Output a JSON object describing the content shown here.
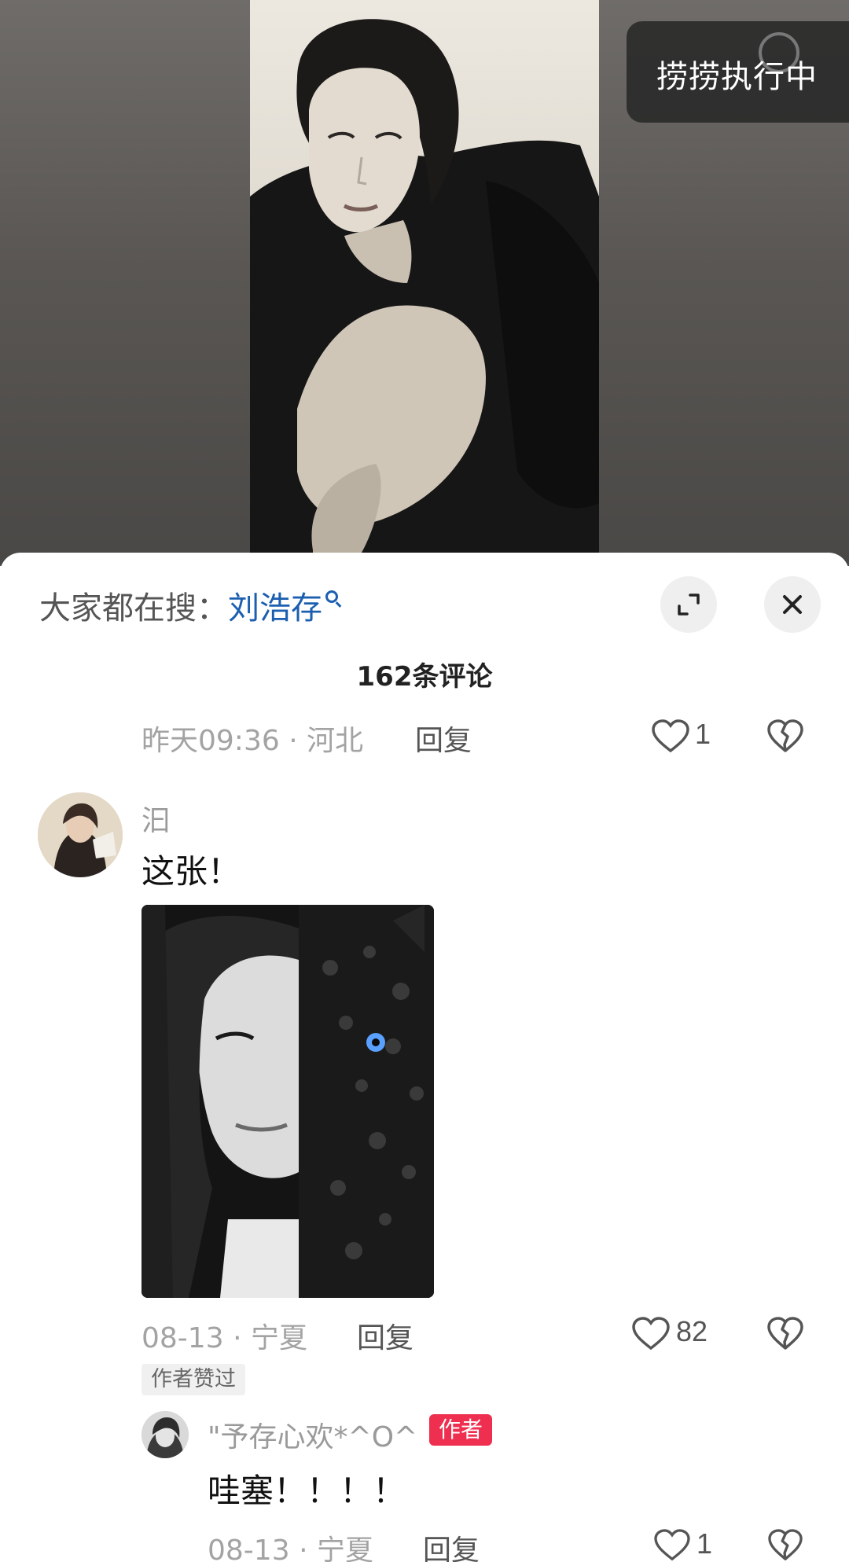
{
  "overlay": {
    "exec_label": "捞捞执行中"
  },
  "sheet": {
    "search_prefix": "大家都在搜：",
    "search_keyword": "刘浩存",
    "comment_count": "162条评论"
  },
  "comments": [
    {
      "time": "昨天09:36",
      "location": "河北",
      "reply": "回复",
      "likes": "1"
    },
    {
      "username": "汩",
      "text": "这张！",
      "time": "08-13",
      "location": "宁夏",
      "reply": "回复",
      "likes": "82",
      "badge": "作者赞过",
      "replies": [
        {
          "username": "\"予存心欢*^O^",
          "author_badge": "作者",
          "text": "哇塞！！！！",
          "time": "08-13",
          "location": "宁夏",
          "reply": "回复",
          "likes": "1"
        }
      ]
    }
  ],
  "separator": "·",
  "icons": {
    "expand": "expand-icon",
    "close": "close-icon",
    "like": "heart-icon",
    "dislike": "broken-heart-icon",
    "search": "search-icon"
  }
}
